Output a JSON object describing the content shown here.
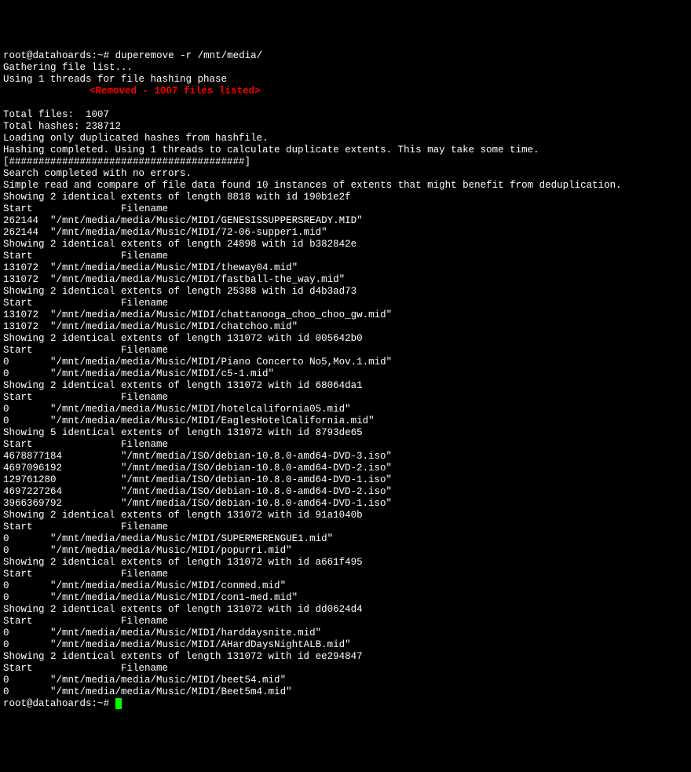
{
  "prompt_user_host": "root@datahoards",
  "prompt_path": "~",
  "command": "duperemove -r /mnt/media/",
  "line_gathering": "Gathering file list...",
  "line_threads": "Using 1 threads for file hashing phase",
  "removed_note": "<Removed - 1007 files listed>",
  "total_files": "Total files:  1007",
  "total_hashes": "Total hashes: 238712",
  "line_loading": "Loading only duplicated hashes from hashfile.",
  "line_hashing": "Hashing completed. Using 1 threads to calculate duplicate extents. This may take some time.",
  "progress_bar": "[########################################]",
  "line_search_done": "Search completed with no errors.",
  "line_simple": "Simple read and compare of file data found 10 instances of extents that might benefit from deduplication.",
  "hdr_start": "Start",
  "hdr_filename": "Filename",
  "groups": [
    {
      "header": "Showing 2 identical extents of length 8818 with id 190b1e2f",
      "rows": [
        {
          "start": "262144",
          "file": "\"/mnt/media/media/Music/MIDI/GENESISSUPPERSREADY.MID\""
        },
        {
          "start": "262144",
          "file": "\"/mnt/media/media/Music/MIDI/72-06-supper1.mid\""
        }
      ]
    },
    {
      "header": "Showing 2 identical extents of length 24898 with id b382842e",
      "rows": [
        {
          "start": "131072",
          "file": "\"/mnt/media/media/Music/MIDI/theway04.mid\""
        },
        {
          "start": "131072",
          "file": "\"/mnt/media/media/Music/MIDI/fastball-the_way.mid\""
        }
      ]
    },
    {
      "header": "Showing 2 identical extents of length 25388 with id d4b3ad73",
      "rows": [
        {
          "start": "131072",
          "file": "\"/mnt/media/media/Music/MIDI/chattanooga_choo_choo_gw.mid\""
        },
        {
          "start": "131072",
          "file": "\"/mnt/media/media/Music/MIDI/chatchoo.mid\""
        }
      ]
    },
    {
      "header": "Showing 2 identical extents of length 131072 with id 005642b0",
      "rows": [
        {
          "start": "0",
          "file": "\"/mnt/media/media/Music/MIDI/Piano Concerto No5,Mov.1.mid\""
        },
        {
          "start": "0",
          "file": "\"/mnt/media/media/Music/MIDI/c5-1.mid\""
        }
      ]
    },
    {
      "header": "Showing 2 identical extents of length 131072 with id 68064da1",
      "rows": [
        {
          "start": "0",
          "file": "\"/mnt/media/media/Music/MIDI/hotelcalifornia05.mid\""
        },
        {
          "start": "0",
          "file": "\"/mnt/media/media/Music/MIDI/EaglesHotelCalifornia.mid\""
        }
      ]
    },
    {
      "header": "Showing 5 identical extents of length 131072 with id 8793de65",
      "rows": [
        {
          "start": "4678877184",
          "file": "\"/mnt/media/ISO/debian-10.8.0-amd64-DVD-3.iso\""
        },
        {
          "start": "4697096192",
          "file": "\"/mnt/media/ISO/debian-10.8.0-amd64-DVD-2.iso\""
        },
        {
          "start": "129761280",
          "file": "\"/mnt/media/ISO/debian-10.8.0-amd64-DVD-1.iso\""
        },
        {
          "start": "4697227264",
          "file": "\"/mnt/media/ISO/debian-10.8.0-amd64-DVD-2.iso\""
        },
        {
          "start": "3966369792",
          "file": "\"/mnt/media/ISO/debian-10.8.0-amd64-DVD-1.iso\""
        }
      ]
    },
    {
      "header": "Showing 2 identical extents of length 131072 with id 91a1040b",
      "rows": [
        {
          "start": "0",
          "file": "\"/mnt/media/media/Music/MIDI/SUPERMERENGUE1.mid\""
        },
        {
          "start": "0",
          "file": "\"/mnt/media/media/Music/MIDI/popurri.mid\""
        }
      ]
    },
    {
      "header": "Showing 2 identical extents of length 131072 with id a661f495",
      "rows": [
        {
          "start": "0",
          "file": "\"/mnt/media/media/Music/MIDI/conmed.mid\""
        },
        {
          "start": "0",
          "file": "\"/mnt/media/media/Music/MIDI/con1-med.mid\""
        }
      ]
    },
    {
      "header": "Showing 2 identical extents of length 131072 with id dd0624d4",
      "rows": [
        {
          "start": "0",
          "file": "\"/mnt/media/media/Music/MIDI/harddaysnite.mid\""
        },
        {
          "start": "0",
          "file": "\"/mnt/media/media/Music/MIDI/AHardDaysNightALB.mid\""
        }
      ]
    },
    {
      "header": "Showing 2 identical extents of length 131072 with id ee294847",
      "rows": [
        {
          "start": "0",
          "file": "\"/mnt/media/media/Music/MIDI/beet54.mid\""
        },
        {
          "start": "0",
          "file": "\"/mnt/media/media/Music/MIDI/Beet5m4.mid\""
        }
      ]
    }
  ]
}
